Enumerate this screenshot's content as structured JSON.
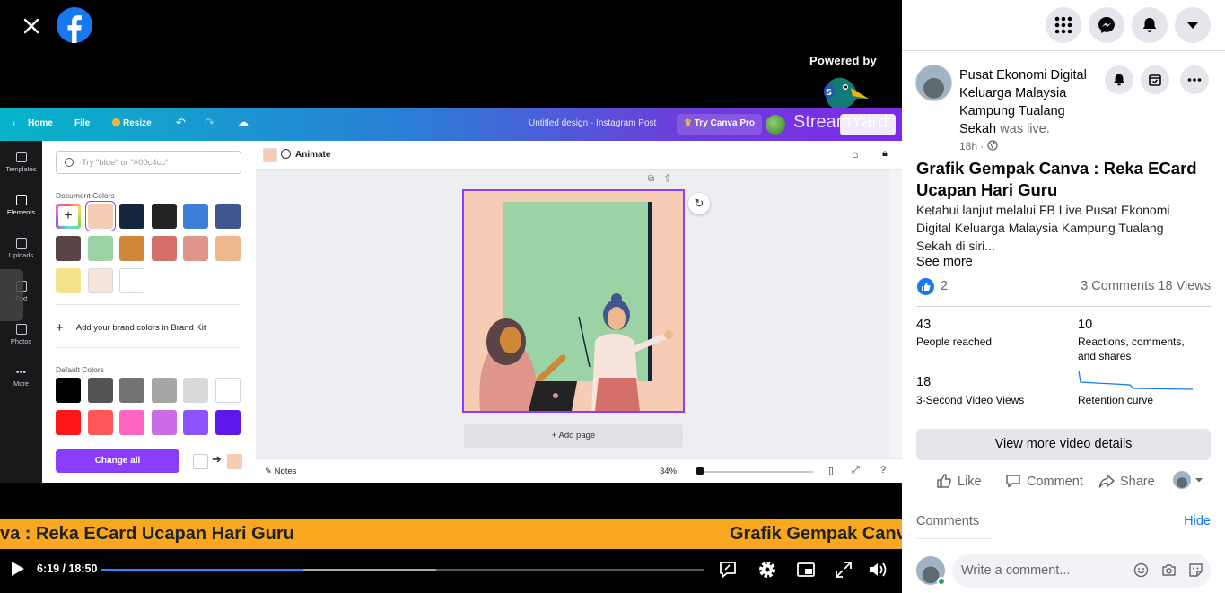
{
  "player": {
    "powered_by": "Powered by",
    "time": "6:19 / 18:50",
    "progress_fraction": 0.335,
    "buffered_fraction": 0.556
  },
  "canva": {
    "nav": {
      "home": "Home",
      "file": "File",
      "resize": "Resize",
      "design_title": "Untitled design - Instagram Post",
      "try_pro": "Try Canva Pro",
      "overlay_brand": "StreamYard"
    },
    "rail": [
      {
        "label": "Templates"
      },
      {
        "label": "Elements"
      },
      {
        "label": "Uploads"
      },
      {
        "label": "Text"
      },
      {
        "label": "Photos"
      },
      {
        "label": "More"
      }
    ],
    "panel": {
      "search_placeholder": "Try \"blue\" or \"#00c4cc\"",
      "document_colors_label": "Document Colors",
      "document_colors": [
        "#f6cdb4",
        "#13263d",
        "#232323",
        "#3b7fd8",
        "#3f5690",
        "#5b4445",
        "#9bd3a5",
        "#d08838",
        "#d56f69",
        "#e0968d",
        "#eeb88e",
        "#f5e38c",
        "#f7e4dd",
        "#ffffff"
      ],
      "add_brand": "Add your brand colors in Brand Kit",
      "default_colors_label": "Default Colors",
      "default_colors": [
        "#000000",
        "#545454",
        "#737373",
        "#a6a6a6",
        "#d9d9d9",
        "#ffffff",
        "#ff1616",
        "#ff5757",
        "#ff66c4",
        "#cb6ce6",
        "#8c52ff",
        "#5e17eb"
      ],
      "change_all": "Change all"
    },
    "toolbar": {
      "animate": "Animate"
    },
    "canvas": {
      "add_page": "+ Add page"
    },
    "footer": {
      "notes": "Notes",
      "zoom": "34%"
    }
  },
  "ticker": {
    "text_left": "va : Reka ECard Ucapan Hari Guru",
    "text_right": "Grafik Gempak Canva : Reka ECard Ucapan Hari Guru"
  },
  "post": {
    "page_name": "Pusat Ekonomi Digital Keluarga Malaysia Kampung Tualang Sekah",
    "live_suffix": "was live.",
    "time": "18h ·",
    "title": "Grafik Gempak Canva : Reka ECard Ucapan Hari Guru",
    "description": "Ketahui lanjut melalui FB Live Pusat Ekonomi Digital Keluarga Malaysia Kampung Tualang Sekah di siri...",
    "see_more": "See more",
    "likes": "2",
    "comments_views": "3 Comments  18 Views",
    "stats": {
      "reached_value": "43",
      "reached_label": "People reached",
      "reactions_value": "10",
      "reactions_label": "Reactions, comments, and shares",
      "views3s_value": "18",
      "views3s_label": "3-Second Video Views",
      "retention_label": "Retention curve"
    },
    "view_more": "View more video details",
    "actions": {
      "like": "Like",
      "comment": "Comment",
      "share": "Share"
    },
    "comments_label": "Comments",
    "hide": "Hide",
    "write_placeholder": "Write a comment..."
  },
  "colors": {
    "accent": "#1877f2",
    "canva_purple": "#8b3dff",
    "ticker": "#f8a81f"
  }
}
